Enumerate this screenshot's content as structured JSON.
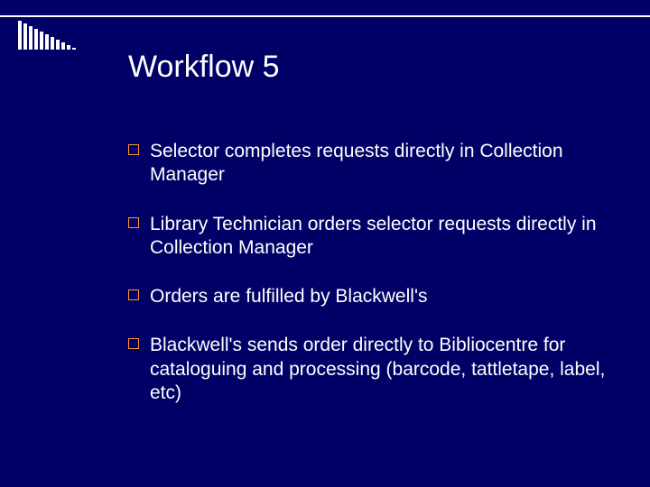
{
  "slide": {
    "title": "Workflow 5",
    "bullets": [
      {
        "text": "Selector completes requests directly in Collection Manager"
      },
      {
        "text": "Library Technician orders selector requests directly in Collection Manager"
      },
      {
        "text": "Orders are fulfilled by Blackwell's"
      },
      {
        "text": "Blackwell's sends order directly to Bibliocentre for cataloguing and processing (barcode, tattletape, label, etc)"
      }
    ]
  }
}
